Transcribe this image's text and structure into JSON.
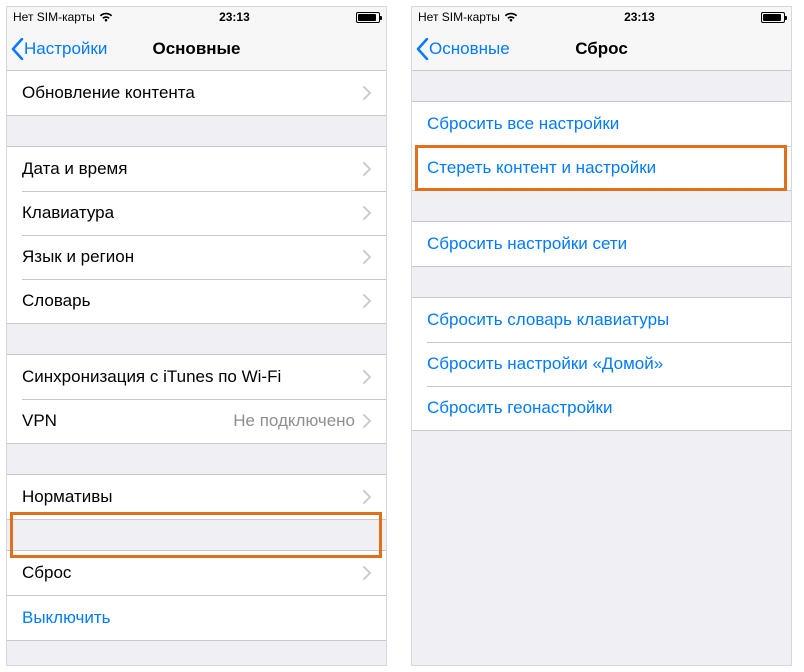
{
  "status": {
    "carrier": "Нет SIM-карты",
    "time": "23:13"
  },
  "left_screen": {
    "back_label": "Настройки",
    "title": "Основные",
    "sections": [
      {
        "rows": [
          {
            "label": "Обновление контента",
            "chevron": true
          }
        ]
      },
      {
        "rows": [
          {
            "label": "Дата и время",
            "chevron": true
          },
          {
            "label": "Клавиатура",
            "chevron": true
          },
          {
            "label": "Язык и регион",
            "chevron": true
          },
          {
            "label": "Словарь",
            "chevron": true
          }
        ]
      },
      {
        "rows": [
          {
            "label": "Синхронизация с iTunes по Wi-Fi",
            "chevron": true
          },
          {
            "label": "VPN",
            "detail": "Не подключено",
            "chevron": true
          }
        ]
      },
      {
        "rows": [
          {
            "label": "Нормативы",
            "chevron": true
          }
        ]
      },
      {
        "rows": [
          {
            "label": "Сброс",
            "chevron": true
          }
        ]
      },
      {
        "rows": [
          {
            "label": "Выключить",
            "link": true
          }
        ]
      }
    ]
  },
  "right_screen": {
    "back_label": "Основные",
    "title": "Сброс",
    "sections": [
      {
        "rows": [
          {
            "label": "Сбросить все настройки",
            "link": true
          },
          {
            "label": "Стереть контент и настройки",
            "link": true
          }
        ]
      },
      {
        "rows": [
          {
            "label": "Сбросить настройки сети",
            "link": true
          }
        ]
      },
      {
        "rows": [
          {
            "label": "Сбросить словарь клавиатуры",
            "link": true
          },
          {
            "label": "Сбросить настройки «Домой»",
            "link": true
          },
          {
            "label": "Сбросить геонастройки",
            "link": true
          }
        ]
      }
    ]
  }
}
